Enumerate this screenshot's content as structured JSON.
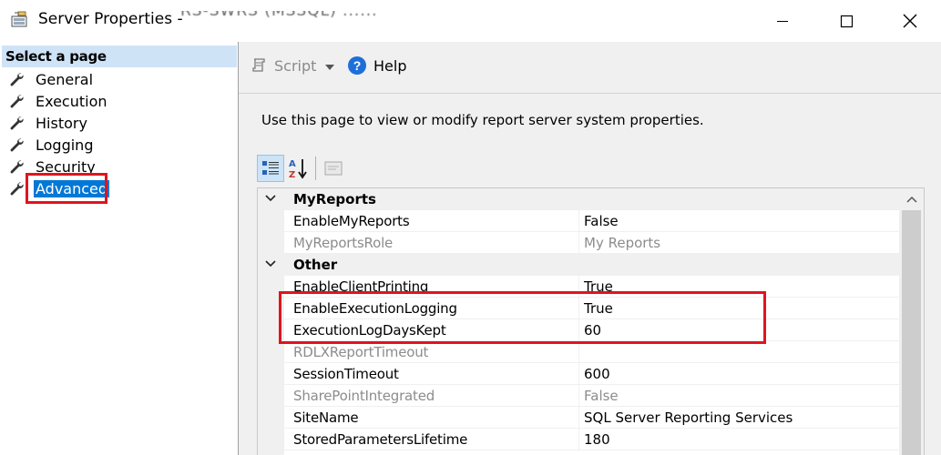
{
  "window": {
    "title": "Server Properties - ",
    "title_obscured": "RS-SWRS (MSSQL) ...... ..........."
  },
  "left_pane": {
    "header": "Select a page",
    "items": [
      {
        "label": "General"
      },
      {
        "label": "Execution"
      },
      {
        "label": "History"
      },
      {
        "label": "Logging"
      },
      {
        "label": "Security"
      },
      {
        "label": "Advanced",
        "selected": true
      }
    ]
  },
  "toolbar": {
    "script_label": "Script",
    "help_label": "Help"
  },
  "description": "Use this page to view or modify report server system properties.",
  "property_grid": {
    "categories": [
      {
        "name": "MyReports",
        "properties": [
          {
            "name": "EnableMyReports",
            "value": "False",
            "readonly": false
          },
          {
            "name": "MyReportsRole",
            "value": "My Reports",
            "readonly": true
          }
        ]
      },
      {
        "name": "Other",
        "properties": [
          {
            "name": "EnableClientPrinting",
            "value": "True",
            "readonly": false
          },
          {
            "name": "EnableExecutionLogging",
            "value": "True",
            "readonly": false
          },
          {
            "name": "ExecutionLogDaysKept",
            "value": "60",
            "readonly": false
          },
          {
            "name": "RDLXReportTimeout",
            "value": "",
            "readonly": true
          },
          {
            "name": "SessionTimeout",
            "value": "600",
            "readonly": false
          },
          {
            "name": "SharePointIntegrated",
            "value": "False",
            "readonly": true
          },
          {
            "name": "SiteName",
            "value": "SQL Server Reporting Services",
            "readonly": false
          },
          {
            "name": "StoredParametersLifetime",
            "value": "180",
            "readonly": false
          }
        ]
      }
    ]
  },
  "colors": {
    "highlight_box": "#e0141e",
    "selection": "#0078d7",
    "header_bg": "#cfe3f7"
  }
}
